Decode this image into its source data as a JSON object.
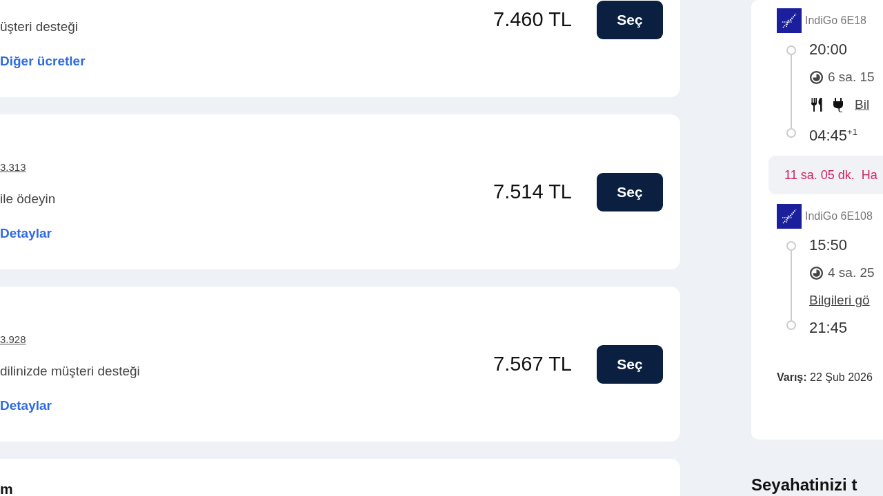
{
  "fares": [
    {
      "description": "üşteri desteği",
      "link": "Diğer ücretler",
      "price": "7.460 TL",
      "button": "Seç"
    },
    {
      "amount": "3.313",
      "description": "ile ödeyin",
      "link": "Detaylar",
      "price": "7.514 TL",
      "button": "Seç"
    },
    {
      "amount": "3.928",
      "description": "dilinizde müşteri desteği",
      "link": "Detaylar",
      "price": "7.567 TL",
      "button": "Seç"
    },
    {
      "title": "m"
    }
  ],
  "itinerary": {
    "segments": [
      {
        "flight": "IndiGo 6E18",
        "departure": "20:00",
        "duration": "6 sa. 15",
        "amenities": true,
        "info_link": "Bil",
        "arrival": "04:45",
        "arrival_day": "+1"
      },
      {
        "flight": "IndiGo 6E108",
        "departure": "15:50",
        "duration": "4 sa. 25",
        "amenities": false,
        "info_link": "Bilgileri gö",
        "arrival": "21:45"
      }
    ],
    "layover": "11 sa. 05 dk.  Ha",
    "arrival_note": "**Varış:** 22 Şub 2026"
  },
  "next_heading": "Seyahatinizi t"
}
